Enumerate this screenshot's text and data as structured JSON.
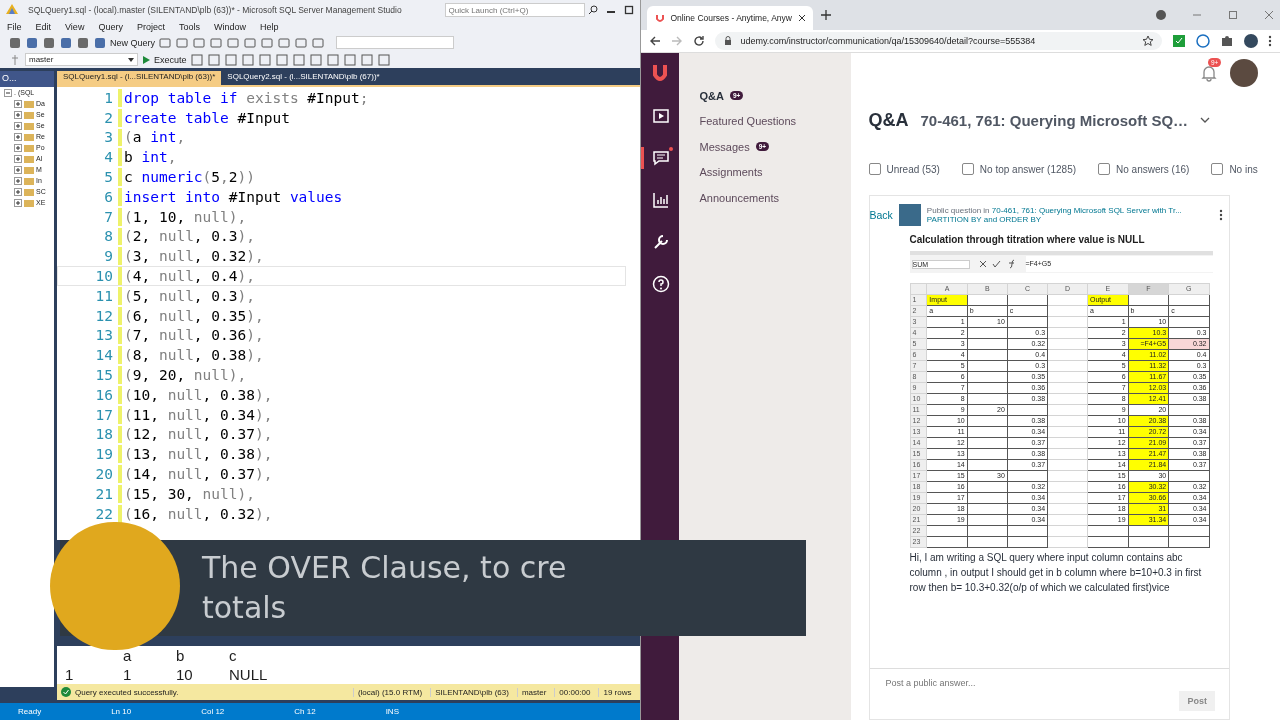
{
  "ssms": {
    "title": "SQLQuery1.sql - (local).master (SILENTAND\\plb (63))* - Microsoft SQL Server Management Studio",
    "quick_launch": {
      "placeholder": "Quick Launch (Ctrl+Q)"
    },
    "menu": [
      "File",
      "Edit",
      "View",
      "Query",
      "Project",
      "Tools",
      "Window",
      "Help"
    ],
    "new_query": "New Query",
    "execute": "Execute",
    "database": "master",
    "explorer": {
      "title": "O...",
      "items": [
        {
          "label": ". (SQL",
          "expanded": true,
          "children": [
            {
              "label": "Da",
              "expanded": false
            },
            {
              "label": "Se",
              "expanded": false
            },
            {
              "label": "Se",
              "expanded": false
            },
            {
              "label": "Re",
              "expanded": false
            },
            {
              "label": "Po",
              "expanded": false
            },
            {
              "label": "Al",
              "expanded": false
            },
            {
              "label": "M",
              "expanded": false
            },
            {
              "label": "In",
              "expanded": false
            },
            {
              "label": "SC",
              "expanded": false
            },
            {
              "label": "XE",
              "expanded": false
            }
          ]
        }
      ]
    },
    "tabs": [
      {
        "label": "SQLQuery1.sql - (l...SILENTAND\\plb (63))*",
        "selected": true
      },
      {
        "label": "SQLQuery2.sql - (l...SILENTAND\\plb (67))*",
        "selected": false
      }
    ],
    "lines": [
      {
        "n": "1",
        "current": false,
        "seg": [
          {
            "kind": "keyword",
            "text": "drop table if"
          },
          {
            "kind": "muted",
            "text": " exists"
          },
          {
            "kind": "plain",
            "text": " #Input"
          },
          {
            "kind": "muted",
            "text": ";"
          }
        ]
      },
      {
        "n": "2",
        "current": false,
        "seg": [
          {
            "kind": "keyword",
            "text": "create table"
          },
          {
            "kind": "plain",
            "text": " #Input"
          }
        ]
      },
      {
        "n": "3",
        "current": false,
        "seg": [
          {
            "kind": "muted",
            "text": "("
          },
          {
            "kind": "plain",
            "text": "a "
          },
          {
            "kind": "keyword",
            "text": "int"
          },
          {
            "kind": "muted",
            "text": ","
          }
        ]
      },
      {
        "n": "4",
        "current": false,
        "seg": [
          {
            "kind": "plain",
            "text": "b "
          },
          {
            "kind": "keyword",
            "text": "int"
          },
          {
            "kind": "muted",
            "text": ","
          }
        ]
      },
      {
        "n": "5",
        "current": false,
        "seg": [
          {
            "kind": "plain",
            "text": "c "
          },
          {
            "kind": "keyword",
            "text": "numeric"
          },
          {
            "kind": "muted",
            "text": "("
          },
          {
            "kind": "plain",
            "text": "5"
          },
          {
            "kind": "muted",
            "text": ","
          },
          {
            "kind": "plain",
            "text": "2"
          },
          {
            "kind": "muted",
            "text": "))"
          }
        ]
      },
      {
        "n": "6",
        "current": false,
        "seg": [
          {
            "kind": "keyword",
            "text": "insert into"
          },
          {
            "kind": "plain",
            "text": " #Input "
          },
          {
            "kind": "keyword",
            "text": "values"
          }
        ]
      },
      {
        "n": "7",
        "current": false,
        "seg": [
          {
            "kind": "muted",
            "text": "("
          },
          {
            "kind": "plain",
            "text": "1, 10, "
          },
          {
            "kind": "muted",
            "text": "null),"
          }
        ]
      },
      {
        "n": "8",
        "current": false,
        "seg": [
          {
            "kind": "muted",
            "text": "("
          },
          {
            "kind": "plain",
            "text": "2, "
          },
          {
            "kind": "muted",
            "text": "null"
          },
          {
            "kind": "plain",
            "text": ", 0.3"
          },
          {
            "kind": "muted",
            "text": "),"
          }
        ]
      },
      {
        "n": "9",
        "current": false,
        "seg": [
          {
            "kind": "muted",
            "text": "("
          },
          {
            "kind": "plain",
            "text": "3, "
          },
          {
            "kind": "muted",
            "text": "null"
          },
          {
            "kind": "plain",
            "text": ", 0.32"
          },
          {
            "kind": "muted",
            "text": "),"
          }
        ]
      },
      {
        "n": "10",
        "current": true,
        "seg": [
          {
            "kind": "muted",
            "text": "("
          },
          {
            "kind": "plain",
            "text": "4, "
          },
          {
            "kind": "muted",
            "text": "null"
          },
          {
            "kind": "plain",
            "text": ", 0.4"
          },
          {
            "kind": "muted",
            "text": "),"
          }
        ]
      },
      {
        "n": "11",
        "current": false,
        "seg": [
          {
            "kind": "muted",
            "text": "("
          },
          {
            "kind": "plain",
            "text": "5, "
          },
          {
            "kind": "muted",
            "text": "null"
          },
          {
            "kind": "plain",
            "text": ", 0.3"
          },
          {
            "kind": "muted",
            "text": "),"
          }
        ]
      },
      {
        "n": "12",
        "current": false,
        "seg": [
          {
            "kind": "muted",
            "text": "("
          },
          {
            "kind": "plain",
            "text": "6, "
          },
          {
            "kind": "muted",
            "text": "null"
          },
          {
            "kind": "plain",
            "text": ", 0.35"
          },
          {
            "kind": "muted",
            "text": "),"
          }
        ]
      },
      {
        "n": "13",
        "current": false,
        "seg": [
          {
            "kind": "muted",
            "text": "("
          },
          {
            "kind": "plain",
            "text": "7, "
          },
          {
            "kind": "muted",
            "text": "null"
          },
          {
            "kind": "plain",
            "text": ", 0.36"
          },
          {
            "kind": "muted",
            "text": "),"
          }
        ]
      },
      {
        "n": "14",
        "current": false,
        "seg": [
          {
            "kind": "muted",
            "text": "("
          },
          {
            "kind": "plain",
            "text": "8, "
          },
          {
            "kind": "muted",
            "text": "null"
          },
          {
            "kind": "plain",
            "text": ", 0.38"
          },
          {
            "kind": "muted",
            "text": "),"
          }
        ]
      },
      {
        "n": "15",
        "current": false,
        "seg": [
          {
            "kind": "muted",
            "text": "("
          },
          {
            "kind": "plain",
            "text": "9, 20, "
          },
          {
            "kind": "muted",
            "text": "null),"
          }
        ]
      },
      {
        "n": "16",
        "current": false,
        "seg": [
          {
            "kind": "muted",
            "text": "("
          },
          {
            "kind": "plain",
            "text": "10, "
          },
          {
            "kind": "muted",
            "text": "null"
          },
          {
            "kind": "plain",
            "text": ", 0.38"
          },
          {
            "kind": "muted",
            "text": "),"
          }
        ]
      },
      {
        "n": "17",
        "current": false,
        "seg": [
          {
            "kind": "muted",
            "text": "("
          },
          {
            "kind": "plain",
            "text": "11, "
          },
          {
            "kind": "muted",
            "text": "null"
          },
          {
            "kind": "plain",
            "text": ", 0.34"
          },
          {
            "kind": "muted",
            "text": "),"
          }
        ]
      },
      {
        "n": "18",
        "current": false,
        "seg": [
          {
            "kind": "muted",
            "text": "("
          },
          {
            "kind": "plain",
            "text": "12, "
          },
          {
            "kind": "muted",
            "text": "null"
          },
          {
            "kind": "plain",
            "text": ", 0.37"
          },
          {
            "kind": "muted",
            "text": "),"
          }
        ]
      },
      {
        "n": "19",
        "current": false,
        "seg": [
          {
            "kind": "muted",
            "text": "("
          },
          {
            "kind": "plain",
            "text": "13, "
          },
          {
            "kind": "muted",
            "text": "null"
          },
          {
            "kind": "plain",
            "text": ", 0.38"
          },
          {
            "kind": "muted",
            "text": "),"
          }
        ]
      },
      {
        "n": "20",
        "current": false,
        "seg": [
          {
            "kind": "muted",
            "text": "("
          },
          {
            "kind": "plain",
            "text": "14, "
          },
          {
            "kind": "muted",
            "text": "null"
          },
          {
            "kind": "plain",
            "text": ", 0.37"
          },
          {
            "kind": "muted",
            "text": "),"
          }
        ]
      },
      {
        "n": "21",
        "current": false,
        "seg": [
          {
            "kind": "muted",
            "text": "("
          },
          {
            "kind": "plain",
            "text": "15, 30, "
          },
          {
            "kind": "muted",
            "text": "null),"
          }
        ]
      },
      {
        "n": "22",
        "current": false,
        "seg": [
          {
            "kind": "muted",
            "text": "("
          },
          {
            "kind": "plain",
            "text": "16, "
          },
          {
            "kind": "muted",
            "text": "null"
          },
          {
            "kind": "plain",
            "text": ", 0.32"
          },
          {
            "kind": "muted",
            "text": "),"
          }
        ]
      }
    ],
    "results": {
      "columns": [
        "a",
        "b",
        "c"
      ],
      "rows": [
        {
          "n": "1",
          "cells": [
            "1",
            "10",
            "NULL"
          ]
        }
      ]
    },
    "query_status": {
      "message": "Query executed successfully.",
      "fields": [
        "(local) (15.0 RTM)",
        "SILENTAND\\plb (63)",
        "master",
        "00:00:00",
        "19 rows"
      ]
    },
    "status_bar": [
      "Ready",
      "Ln 10",
      "Col 12",
      "Ch 12",
      "INS"
    ]
  },
  "browser": {
    "tab": "Online Courses - Anytime, Anyw",
    "url": "udemy.com/instructor/communication/qa/15309640/detail?course=555384",
    "rail": [
      {
        "kind": "video",
        "selected": false,
        "dot": false
      },
      {
        "kind": "chat",
        "selected": true,
        "dot": true
      },
      {
        "kind": "chart",
        "selected": false,
        "dot": false
      },
      {
        "kind": "wrench",
        "selected": false,
        "dot": false
      },
      {
        "kind": "help",
        "selected": false,
        "dot": false
      }
    ],
    "nav": [
      {
        "label": "Q&A",
        "badge": "9+",
        "selected": true
      },
      {
        "label": "Featured Questions",
        "selected": false
      },
      {
        "label": "Messages",
        "badge": "9+",
        "selected": false
      },
      {
        "label": "Assignments",
        "selected": false
      },
      {
        "label": "Announcements",
        "selected": false
      }
    ],
    "notification_badge": "9+",
    "heading": "Q&A",
    "course": "70-461, 761: Querying Microsoft SQ…",
    "filters": [
      {
        "label": "Unread (53)",
        "checked": false
      },
      {
        "label": "No top answer (1285)",
        "checked": false
      },
      {
        "label": "No answers (16)",
        "checked": false
      },
      {
        "label": "No ins",
        "checked": false
      }
    ],
    "question": {
      "back": "Back",
      "prefix": "Public question in",
      "course_link": "70-461, 761: Querying Microsoft SQL Server with Tr...",
      "lecture": "PARTITION BY and ORDER BY",
      "title": "Calculation through titration where value is NULL",
      "sheet": {
        "name_box": "SUM",
        "formula": "=F4+G5",
        "columns": [
          {
            "label": "A",
            "selected": false
          },
          {
            "label": "B",
            "selected": false
          },
          {
            "label": "C",
            "selected": false
          },
          {
            "label": "D",
            "selected": false
          },
          {
            "label": "E",
            "selected": false
          },
          {
            "label": "F",
            "selected": true
          },
          {
            "label": "G",
            "selected": false
          }
        ],
        "rows": [
          {
            "n": "1",
            "cells": [
              {
                "text": "Imput",
                "kind": "yellow"
              },
              {
                "text": ""
              },
              {
                "text": ""
              },
              {
                "text": ""
              },
              {
                "text": "Output",
                "kind": "yellow"
              },
              {
                "text": ""
              },
              {
                "text": ""
              }
            ]
          },
          {
            "n": "2",
            "cells": [
              {
                "text": "a"
              },
              {
                "text": "b"
              },
              {
                "text": "c"
              },
              {
                "text": ""
              },
              {
                "text": "a"
              },
              {
                "text": "b"
              },
              {
                "text": "c"
              }
            ]
          },
          {
            "n": "3",
            "cells": [
              {
                "text": "1"
              },
              {
                "text": "10"
              },
              {
                "text": ""
              },
              {
                "text": ""
              },
              {
                "text": "1"
              },
              {
                "text": "10"
              },
              {
                "text": ""
              }
            ]
          },
          {
            "n": "4",
            "cells": [
              {
                "text": "2"
              },
              {
                "text": ""
              },
              {
                "text": "0.3"
              },
              {
                "text": ""
              },
              {
                "text": "2"
              },
              {
                "text": "10.3",
                "kind": "yellow"
              },
              {
                "text": "0.3"
              }
            ]
          },
          {
            "n": "5",
            "cells": [
              {
                "text": "3"
              },
              {
                "text": ""
              },
              {
                "text": "0.32"
              },
              {
                "text": ""
              },
              {
                "text": "3"
              },
              {
                "text": "=F4+G5",
                "kind": "yellow"
              },
              {
                "text": "0.32",
                "kind": "pink"
              }
            ]
          },
          {
            "n": "6",
            "cells": [
              {
                "text": "4"
              },
              {
                "text": ""
              },
              {
                "text": "0.4"
              },
              {
                "text": ""
              },
              {
                "text": "4"
              },
              {
                "text": "11.02",
                "kind": "yellow"
              },
              {
                "text": "0.4"
              }
            ]
          },
          {
            "n": "7",
            "cells": [
              {
                "text": "5"
              },
              {
                "text": ""
              },
              {
                "text": "0.3"
              },
              {
                "text": ""
              },
              {
                "text": "5"
              },
              {
                "text": "11.32",
                "kind": "yellow"
              },
              {
                "text": "0.3"
              }
            ]
          },
          {
            "n": "8",
            "cells": [
              {
                "text": "6"
              },
              {
                "text": ""
              },
              {
                "text": "0.35"
              },
              {
                "text": ""
              },
              {
                "text": "6"
              },
              {
                "text": "11.67",
                "kind": "yellow"
              },
              {
                "text": "0.35"
              }
            ]
          },
          {
            "n": "9",
            "cells": [
              {
                "text": "7"
              },
              {
                "text": ""
              },
              {
                "text": "0.36"
              },
              {
                "text": ""
              },
              {
                "text": "7"
              },
              {
                "text": "12.03",
                "kind": "yellow"
              },
              {
                "text": "0.36"
              }
            ]
          },
          {
            "n": "10",
            "cells": [
              {
                "text": "8"
              },
              {
                "text": ""
              },
              {
                "text": "0.38"
              },
              {
                "text": ""
              },
              {
                "text": "8"
              },
              {
                "text": "12.41",
                "kind": "yellow"
              },
              {
                "text": "0.38"
              }
            ]
          },
          {
            "n": "11",
            "cells": [
              {
                "text": "9"
              },
              {
                "text": "20"
              },
              {
                "text": ""
              },
              {
                "text": ""
              },
              {
                "text": "9"
              },
              {
                "text": "20"
              },
              {
                "text": ""
              }
            ]
          },
          {
            "n": "12",
            "cells": [
              {
                "text": "10"
              },
              {
                "text": ""
              },
              {
                "text": "0.38"
              },
              {
                "text": ""
              },
              {
                "text": "10"
              },
              {
                "text": "20.38",
                "kind": "yellow"
              },
              {
                "text": "0.38"
              }
            ]
          },
          {
            "n": "13",
            "cells": [
              {
                "text": "11"
              },
              {
                "text": ""
              },
              {
                "text": "0.34"
              },
              {
                "text": ""
              },
              {
                "text": "11"
              },
              {
                "text": "20.72",
                "kind": "yellow"
              },
              {
                "text": "0.34"
              }
            ]
          },
          {
            "n": "14",
            "cells": [
              {
                "text": "12"
              },
              {
                "text": ""
              },
              {
                "text": "0.37"
              },
              {
                "text": ""
              },
              {
                "text": "12"
              },
              {
                "text": "21.09",
                "kind": "yellow"
              },
              {
                "text": "0.37"
              }
            ]
          },
          {
            "n": "15",
            "cells": [
              {
                "text": "13"
              },
              {
                "text": ""
              },
              {
                "text": "0.38"
              },
              {
                "text": ""
              },
              {
                "text": "13"
              },
              {
                "text": "21.47",
                "kind": "yellow"
              },
              {
                "text": "0.38"
              }
            ]
          },
          {
            "n": "16",
            "cells": [
              {
                "text": "14"
              },
              {
                "text": ""
              },
              {
                "text": "0.37"
              },
              {
                "text": ""
              },
              {
                "text": "14"
              },
              {
                "text": "21.84",
                "kind": "yellow"
              },
              {
                "text": "0.37"
              }
            ]
          },
          {
            "n": "17",
            "cells": [
              {
                "text": "15"
              },
              {
                "text": "30"
              },
              {
                "text": ""
              },
              {
                "text": ""
              },
              {
                "text": "15"
              },
              {
                "text": "30"
              },
              {
                "text": ""
              }
            ]
          },
          {
            "n": "18",
            "cells": [
              {
                "text": "16"
              },
              {
                "text": ""
              },
              {
                "text": "0.32"
              },
              {
                "text": ""
              },
              {
                "text": "16"
              },
              {
                "text": "30.32",
                "kind": "yellow"
              },
              {
                "text": "0.32"
              }
            ]
          },
          {
            "n": "19",
            "cells": [
              {
                "text": "17"
              },
              {
                "text": ""
              },
              {
                "text": "0.34"
              },
              {
                "text": ""
              },
              {
                "text": "17"
              },
              {
                "text": "30.66",
                "kind": "yellow"
              },
              {
                "text": "0.34"
              }
            ]
          },
          {
            "n": "20",
            "cells": [
              {
                "text": "18"
              },
              {
                "text": ""
              },
              {
                "text": "0.34"
              },
              {
                "text": ""
              },
              {
                "text": "18"
              },
              {
                "text": "31",
                "kind": "yellow"
              },
              {
                "text": "0.34"
              }
            ]
          },
          {
            "n": "21",
            "cells": [
              {
                "text": "19"
              },
              {
                "text": ""
              },
              {
                "text": "0.34"
              },
              {
                "text": ""
              },
              {
                "text": "19"
              },
              {
                "text": "31.34",
                "kind": "yellow"
              },
              {
                "text": "0.34"
              }
            ]
          },
          {
            "n": "22",
            "cells": [
              {
                "text": ""
              },
              {
                "text": ""
              },
              {
                "text": ""
              },
              {
                "text": ""
              },
              {
                "text": ""
              },
              {
                "text": ""
              },
              {
                "text": ""
              }
            ]
          },
          {
            "n": "23",
            "cells": [
              {
                "text": ""
              },
              {
                "text": ""
              },
              {
                "text": ""
              },
              {
                "text": ""
              },
              {
                "text": ""
              },
              {
                "text": ""
              },
              {
                "text": ""
              }
            ]
          }
        ]
      },
      "body": "Hi, I am writing a SQL query where input column contains abc column , in output I should get in b column where b=10+0.3 in first row then b= 10.3+0.32(o/p of which we calculated first)vice"
    },
    "answer": {
      "placeholder": "Post a public answer...",
      "button": "Post"
    }
  },
  "overlay": {
    "caption_lines": [
      "The OVER Clause, to cre",
      "totals"
    ]
  }
}
